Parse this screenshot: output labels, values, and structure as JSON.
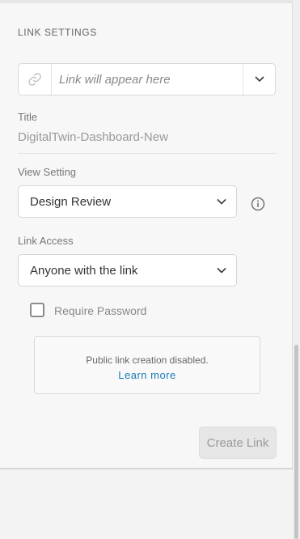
{
  "section_title": "LINK SETTINGS",
  "link": {
    "placeholder": "Link will appear here",
    "link_icon": "link-icon",
    "dropdown_icon": "chevron-down-icon"
  },
  "title": {
    "label": "Title",
    "value": "DigitalTwin-Dashboard-New"
  },
  "view_setting": {
    "label": "View Setting",
    "selected": "Design Review",
    "info_icon": "info-icon"
  },
  "link_access": {
    "label": "Link Access",
    "selected": "Anyone with the link"
  },
  "require_password": {
    "label": "Require Password",
    "checked": false
  },
  "notice": {
    "text": "Public link creation disabled.",
    "link_text": "Learn more"
  },
  "create_button": {
    "label": "Create Link",
    "disabled": true
  },
  "colors": {
    "accent_link": "#1a7bb9",
    "panel_bg": "#f7f7f7"
  }
}
